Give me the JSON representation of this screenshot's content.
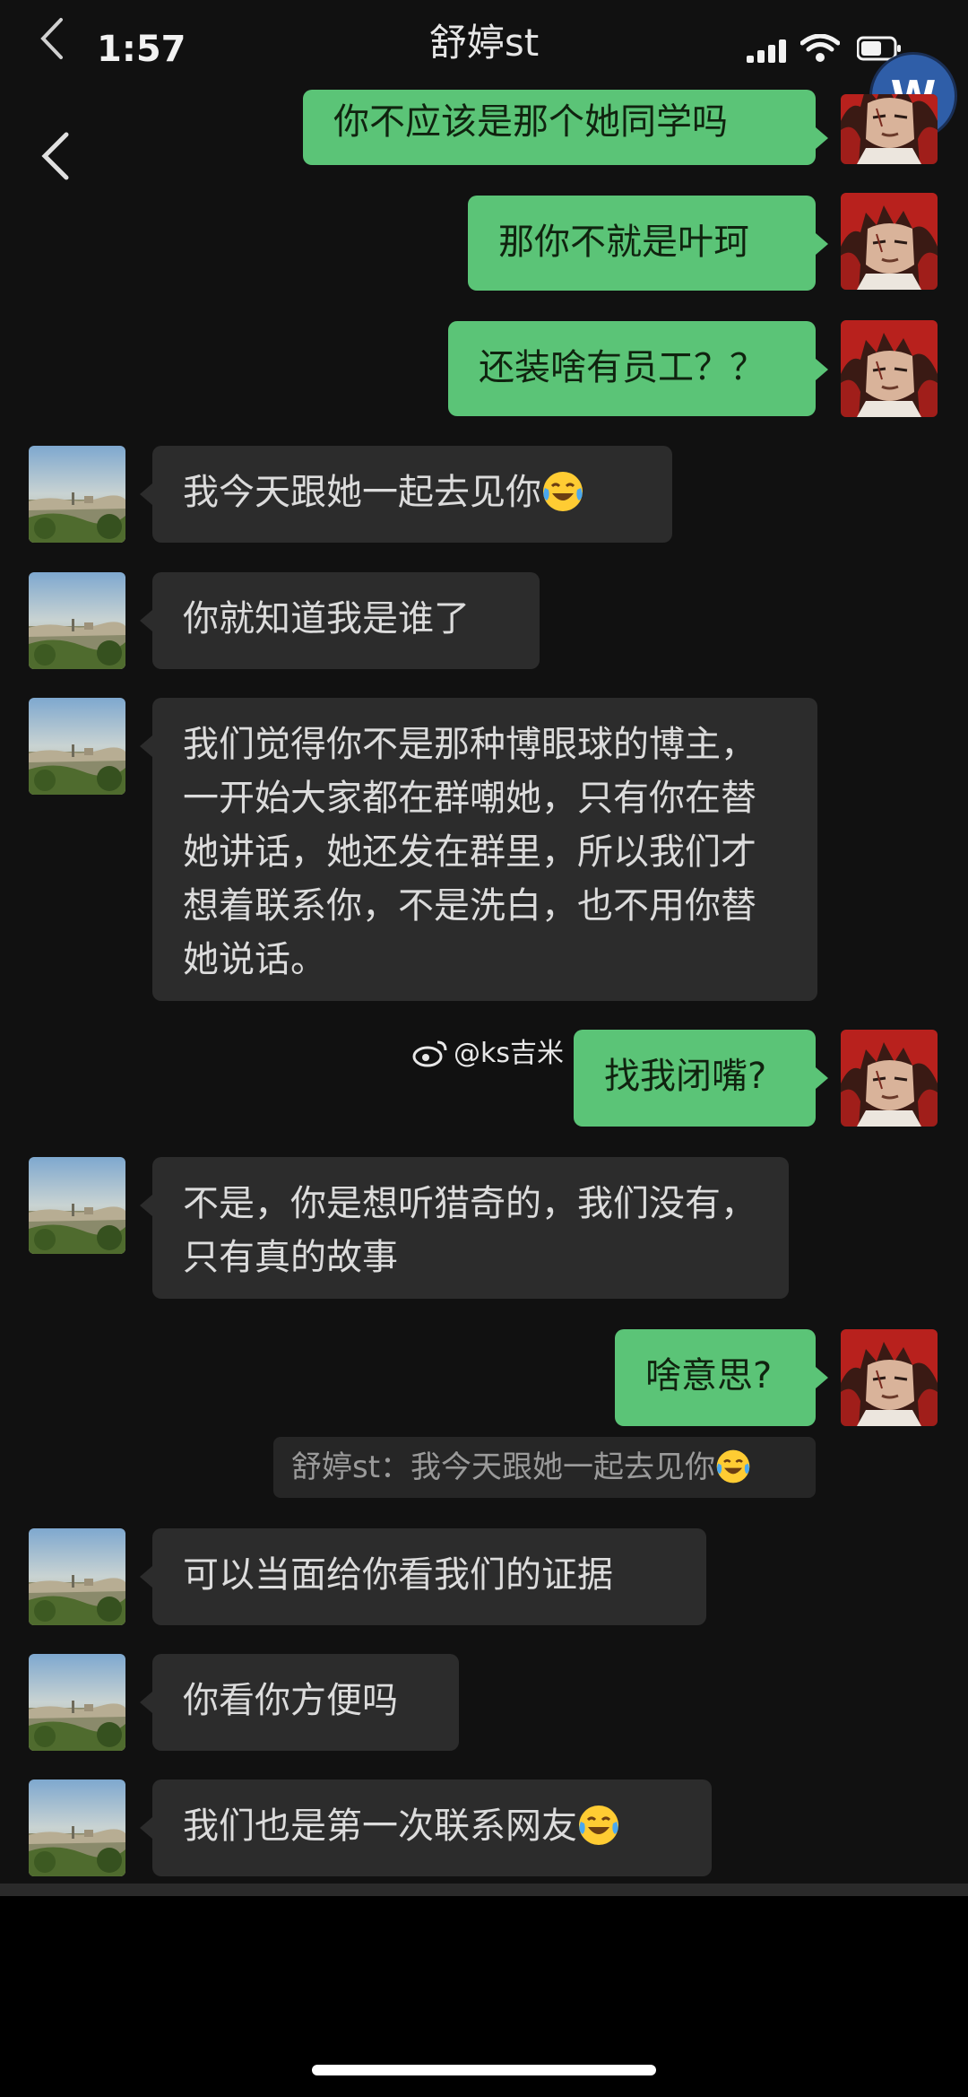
{
  "status": {
    "time": "1:57"
  },
  "header": {
    "title": "舒婷st",
    "profile_initial": "W"
  },
  "messages": [
    {
      "side": "right",
      "text": "你不应该是那个她同学吗"
    },
    {
      "side": "right",
      "text": "那你不就是叶珂"
    },
    {
      "side": "right",
      "text": "还装啥有员工？？"
    },
    {
      "side": "left",
      "text": "我今天跟她一起去见你"
    },
    {
      "side": "left",
      "text": "你就知道我是谁了"
    },
    {
      "side": "left",
      "text": "我们觉得你不是那种博眼球的博主，一开始大家都在群嘲她，只有你在替她讲话，她还发在群里，所以我们才想着联系你，不是洗白，也不用你替她说话。"
    },
    {
      "side": "right",
      "text": "找我闭嘴?"
    },
    {
      "side": "left",
      "text": "不是，你是想听猎奇的，我们没有，只有真的故事"
    },
    {
      "side": "right",
      "text": "啥意思?"
    },
    {
      "side": "left",
      "text": "可以当面给你看我们的证据"
    },
    {
      "side": "left",
      "text": "你看你方便吗"
    },
    {
      "side": "left",
      "text": "我们也是第一次联系网友"
    }
  ],
  "quote": {
    "text": "舒婷st：我今天跟她一起去见你"
  },
  "watermark": {
    "text": "@ks吉米"
  },
  "emoji": "laugh-cry-emoji",
  "colors": {
    "background": "#111111",
    "bubble_self": "#5bc477",
    "bubble_other": "#2c2c2c",
    "profile_badge": "#2f5ea8"
  }
}
